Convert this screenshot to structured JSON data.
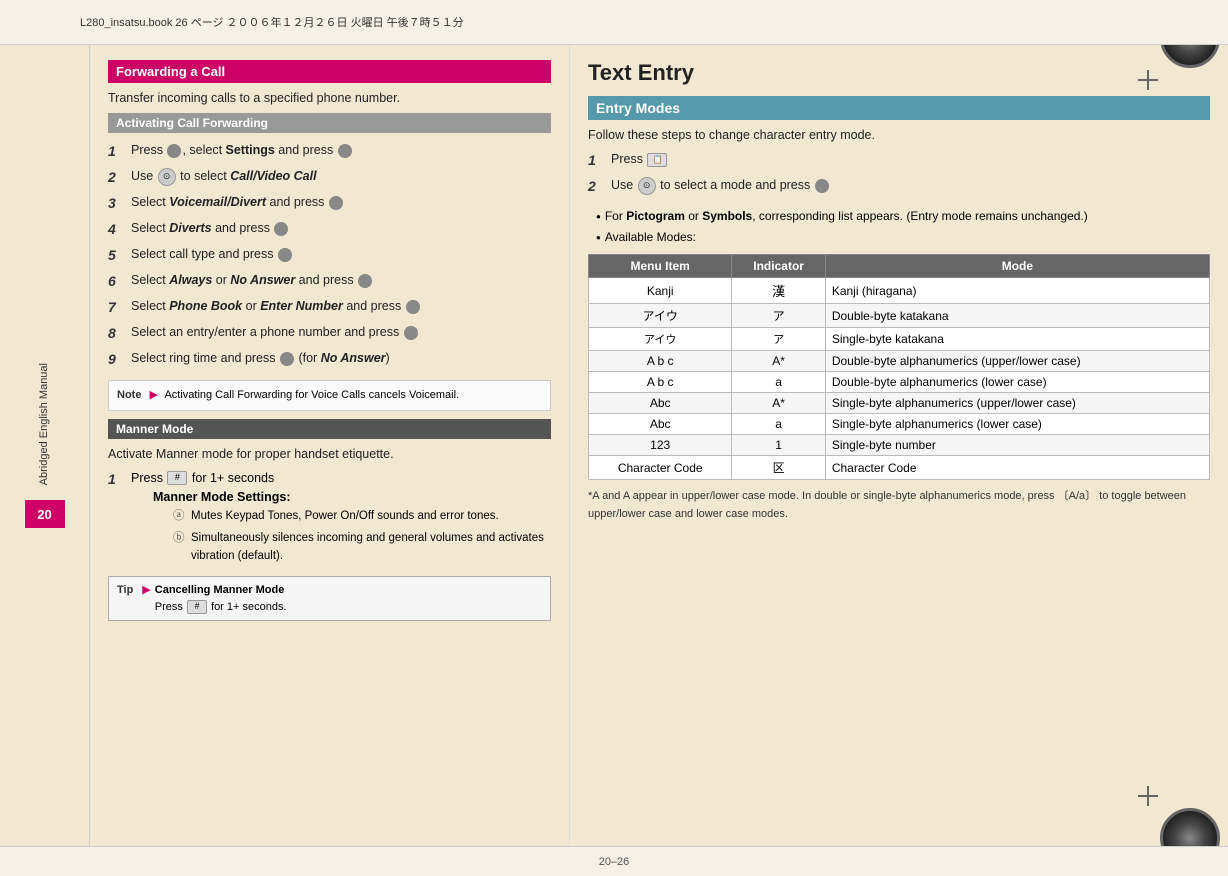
{
  "header": {
    "text": "L280_insatsu.book  26 ページ  ２００６年１２月２６日  火曜日  午後７時５１分"
  },
  "footer": {
    "page_label": "20–26"
  },
  "sidebar": {
    "text_line1": "Abridged English Manual",
    "page_num": "20"
  },
  "left_section": {
    "title": "Forwarding a Call",
    "subtitle": "Transfer incoming calls to a specified phone number.",
    "sub_section": "Activating Call Forwarding",
    "steps": [
      {
        "num": "1",
        "text": "Press ●, select Settings and press ●"
      },
      {
        "num": "2",
        "text": "Use ☉ to select Call/Video Call"
      },
      {
        "num": "3",
        "text": "Select Voicemail/Divert and press ●"
      },
      {
        "num": "4",
        "text": "Select Diverts and press ●"
      },
      {
        "num": "5",
        "text": "Select call type and press ●"
      },
      {
        "num": "6",
        "text": "Select Always or No Answer and press ●"
      },
      {
        "num": "7",
        "text": "Select Phone Book or Enter Number and press ●"
      },
      {
        "num": "8",
        "text": "Select an entry/enter a phone number and press ●"
      },
      {
        "num": "9",
        "text": "Select ring time and press ● (for No Answer)"
      }
    ],
    "note": {
      "label": "Note",
      "arrow": "▶",
      "text": "Activating Call Forwarding for Voice Calls cancels Voicemail."
    },
    "manner_section": {
      "title": "Manner Mode",
      "subtitle": "Activate Manner mode for proper handset etiquette.",
      "step1": {
        "num": "1",
        "main": "Press",
        "key": "#",
        "suffix": "for 1+ seconds",
        "sub_title": "Manner Mode Settings:",
        "sub_a": "Mutes Keypad Tones, Power On/Off sounds and error tones.",
        "sub_b": "Simultaneously silences incoming and general volumes and activates vibration (default)."
      },
      "tip": {
        "label": "Tip",
        "arrow": "▶",
        "line1": "Cancelling Manner Mode",
        "line2": "Press",
        "key": "#",
        "line2_suffix": "for 1+ seconds."
      }
    }
  },
  "right_section": {
    "title": "Text Entry",
    "entry_modes_header": "Entry Modes",
    "intro": "Follow these steps to change character entry mode.",
    "steps": [
      {
        "num": "1",
        "text": "Press",
        "icon": "menu-key"
      },
      {
        "num": "2",
        "text": "Use ⊙ to select a mode and press ●"
      }
    ],
    "bullets": [
      "For Pictogram or Symbols, corresponding list appears. (Entry mode remains unchanged.)",
      "Available Modes:"
    ],
    "table": {
      "headers": [
        "Menu Item",
        "Indicator",
        "Mode"
      ],
      "rows": [
        {
          "menu": "Kanji",
          "indicator": "漢",
          "mode": "Kanji (hiragana)"
        },
        {
          "menu": "アイウ",
          "indicator": "ア",
          "mode": "Double-byte katakana"
        },
        {
          "menu": "アイウ",
          "indicator": "ア",
          "mode": "Single-byte katakana"
        },
        {
          "menu": "A b c",
          "indicator": "A*",
          "mode": "Double-byte alphanumerics (upper/lower case)"
        },
        {
          "menu": "A b c",
          "indicator": "a",
          "mode": "Double-byte alphanumerics (lower case)"
        },
        {
          "menu": "Abc",
          "indicator": "A*",
          "mode": "Single-byte alphanumerics (upper/lower case)"
        },
        {
          "menu": "Abc",
          "indicator": "a",
          "mode": "Single-byte alphanumerics (lower case)"
        },
        {
          "menu": "123",
          "indicator": "1",
          "mode": "Single-byte number"
        },
        {
          "menu": "Character Code",
          "indicator": "区",
          "mode": "Character Code"
        }
      ]
    },
    "footer_note": "*A and A appear in upper/lower case mode. In double or single-byte alphanumerics mode, press 〔A/a〕 to toggle between upper/lower case and lower case modes."
  }
}
